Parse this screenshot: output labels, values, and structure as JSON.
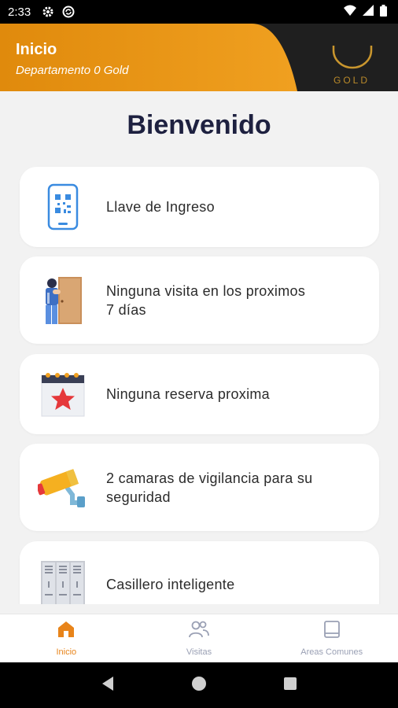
{
  "status_bar": {
    "time": "2:33",
    "icons": [
      "settings-icon",
      "sync-icon",
      "wifi-icon",
      "signal-icon",
      "battery-icon"
    ]
  },
  "header": {
    "title": "Inicio",
    "subtitle": "Departamento 0 Gold",
    "logo_text": "GOLD"
  },
  "main": {
    "welcome": "Bienvenido",
    "cards": [
      {
        "icon": "qr-phone-icon",
        "label_line1": "Llave de Ingreso",
        "label_line2": ""
      },
      {
        "icon": "visitor-door-icon",
        "label_line1": "Ninguna visita en los proximos",
        "label_line2": "7 días"
      },
      {
        "icon": "calendar-star-icon",
        "label_line1": "Ninguna reserva proxima",
        "label_line2": ""
      },
      {
        "icon": "security-camera-icon",
        "label_line1": "2 camaras de vigilancia para su",
        "label_line2": "seguridad"
      },
      {
        "icon": "lockers-icon",
        "label_line1": "Casillero inteligente",
        "label_line2": ""
      }
    ]
  },
  "bottom_nav": {
    "items": [
      {
        "label": "Inicio",
        "icon": "home-icon",
        "active": true
      },
      {
        "label": "Visitas",
        "icon": "people-icon",
        "active": false
      },
      {
        "label": "Areas Comunes",
        "icon": "book-icon",
        "active": false
      }
    ]
  },
  "colors": {
    "accent": "#e8841a",
    "header_dark": "#1f1f1f",
    "title": "#1e2140",
    "gold": "#b8892a"
  }
}
